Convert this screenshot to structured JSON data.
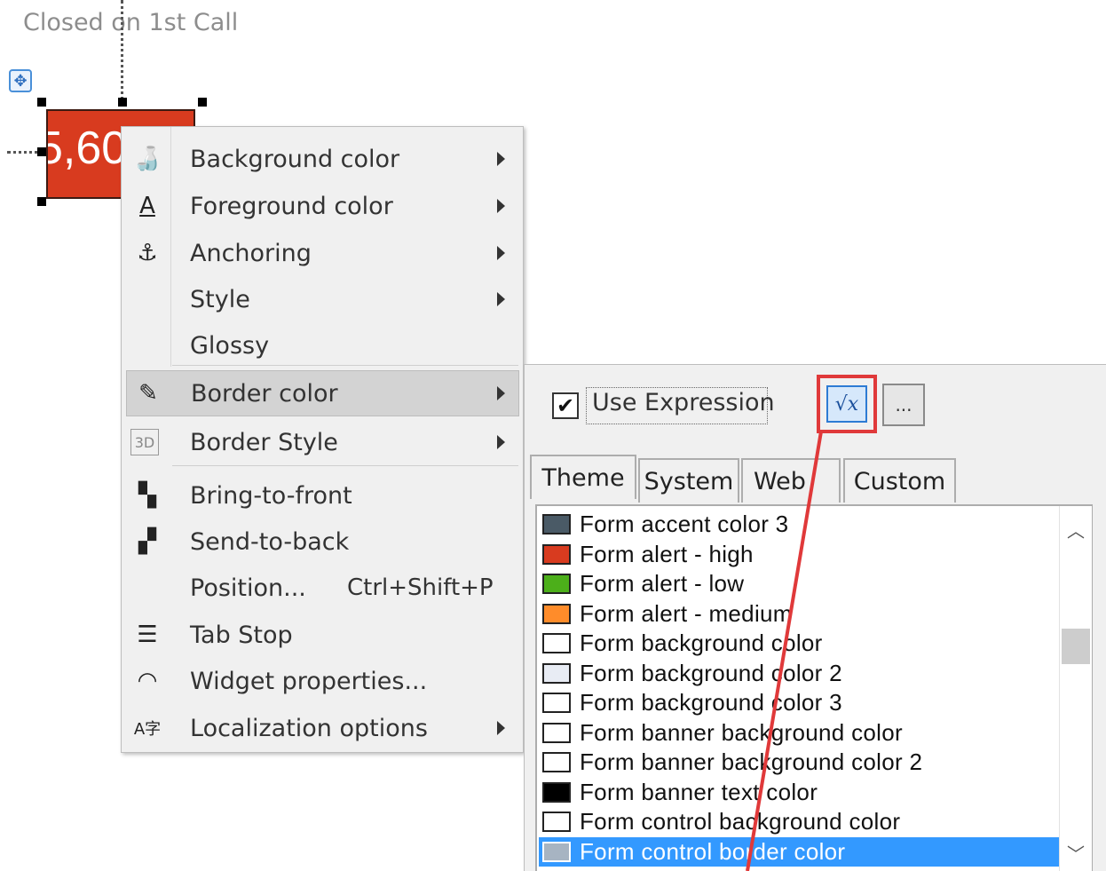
{
  "widget": {
    "title": "Closed on 1st Call",
    "value": "5,60"
  },
  "context_menu": {
    "items": [
      {
        "label": "Background color",
        "icon": "paint-bucket-icon",
        "glyph": "🍶",
        "submenu": true
      },
      {
        "label": "Foreground color",
        "icon": "font-color-icon",
        "glyph": "A",
        "submenu": true
      },
      {
        "label": "Anchoring",
        "icon": "anchor-icon",
        "glyph": "⚓",
        "submenu": true
      },
      {
        "label": "Style",
        "icon": "",
        "glyph": "",
        "submenu": true
      },
      {
        "label": "Glossy",
        "icon": "",
        "glyph": "",
        "submenu": false
      },
      {
        "label": "Border color",
        "icon": "pencil-icon",
        "glyph": "✎",
        "submenu": true,
        "highlighted": true
      },
      {
        "label": "Border Style",
        "icon": "3d-border-icon",
        "glyph": "3D",
        "submenu": true
      },
      {
        "label": "Bring-to-front",
        "icon": "bring-to-front-icon",
        "glyph": "▚",
        "submenu": false
      },
      {
        "label": "Send-to-back",
        "icon": "send-to-back-icon",
        "glyph": "▞",
        "submenu": false
      },
      {
        "label": "Position...",
        "shortcut": "Ctrl+Shift+P",
        "icon": "",
        "glyph": "",
        "submenu": false
      },
      {
        "label": "Tab Stop",
        "icon": "tab-stop-icon",
        "glyph": "☰",
        "submenu": false
      },
      {
        "label": "Widget properties...",
        "icon": "gauge-icon",
        "glyph": "◠",
        "submenu": false
      },
      {
        "label": "Localization options",
        "icon": "localization-icon",
        "glyph": "A字",
        "submenu": true
      }
    ]
  },
  "color_panel": {
    "use_expression_label": "Use Expression",
    "use_expression_checked": true,
    "expression_button": "√x",
    "more_button": "...",
    "tabs": [
      "Theme",
      "System",
      "Web",
      "Custom"
    ],
    "active_tab": "Theme",
    "colors": [
      {
        "name": "Form accent color 3",
        "swatch": "#4a5a66"
      },
      {
        "name": "Form alert - high",
        "swatch": "#d83b1f"
      },
      {
        "name": "Form alert - low",
        "swatch": "#4caf1a"
      },
      {
        "name": "Form alert - medium",
        "swatch": "#ff8c2a"
      },
      {
        "name": "Form background color",
        "swatch": "#ffffff"
      },
      {
        "name": "Form background color 2",
        "swatch": "#e8ecf4"
      },
      {
        "name": "Form background color 3",
        "swatch": "#ffffff"
      },
      {
        "name": "Form banner background color",
        "swatch": "#ffffff"
      },
      {
        "name": "Form banner background color 2",
        "swatch": "#ffffff"
      },
      {
        "name": "Form banner text color",
        "swatch": "#000000"
      },
      {
        "name": "Form control background color",
        "swatch": "#ffffff"
      },
      {
        "name": "Form control border color",
        "swatch": "#a7b4c2",
        "selected": true
      }
    ]
  },
  "colors": {
    "accent_red": "#e0393a",
    "selection_blue": "#3399ff",
    "widget_red": "#d83b1f"
  }
}
